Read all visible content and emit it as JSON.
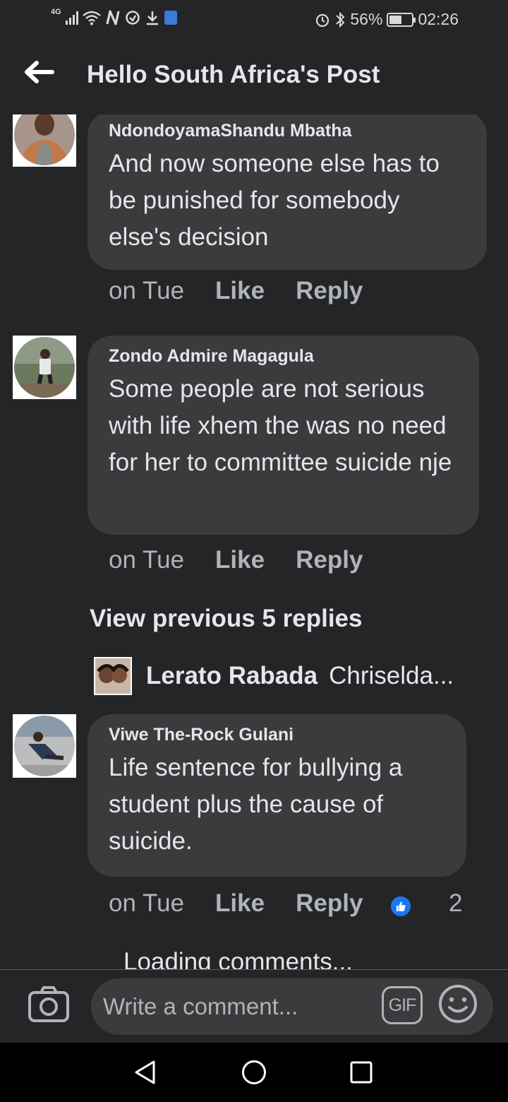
{
  "status_bar": {
    "network": "4G",
    "battery_percent": "56%",
    "battery_level": 0.56,
    "time": "02:26"
  },
  "header": {
    "title": "Hello South Africa's Post"
  },
  "comments": [
    {
      "author": "NdondoyamaShandu Mbatha",
      "text": "And now someone else has to be punished for somebody else's decision",
      "time": "on Tue",
      "like_label": "Like",
      "reply_label": "Reply"
    },
    {
      "author": "Zondo Admire Magagula",
      "text": "Some people are not serious with life xhem the was no need for her to committee suicide nje",
      "time": "on Tue",
      "like_label": "Like",
      "reply_label": "Reply"
    },
    {
      "author": "Viwe The-Rock Gulani",
      "text": "Life sentence for  bullying a student plus the cause of suicide.",
      "time": "on Tue",
      "like_label": "Like",
      "reply_label": "Reply",
      "reaction_count": "2"
    }
  ],
  "view_previous": "View previous 5 replies",
  "reply_preview": {
    "author": "Lerato Rabada",
    "text": "Chriselda..."
  },
  "loading_text": "Loading comments...",
  "composer": {
    "placeholder": "Write a comment...",
    "gif_label": "GIF"
  },
  "colors": {
    "background": "#242526",
    "bubble": "#3a3b3c",
    "primary_text": "#e4e6eb",
    "secondary_text": "#b0b3b8",
    "like_reaction": "#1877f2"
  }
}
